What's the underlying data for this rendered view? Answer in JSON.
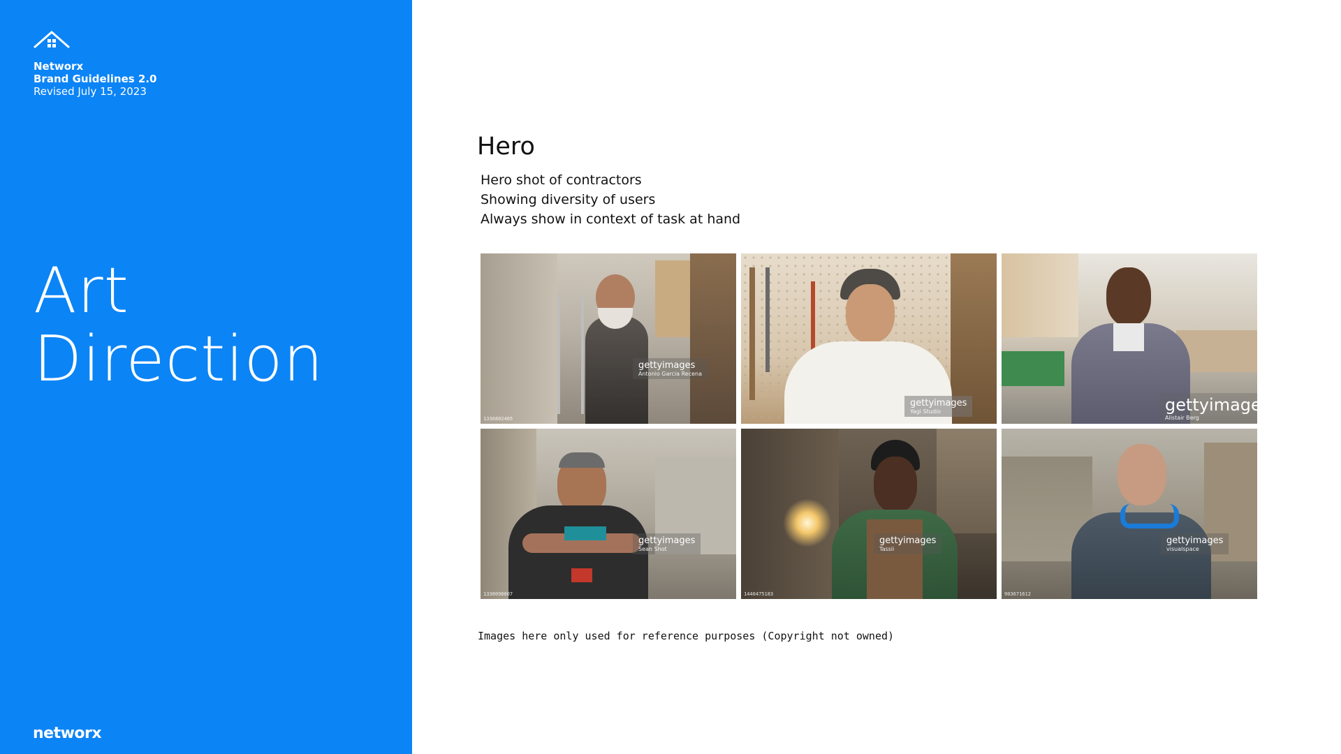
{
  "sidebar": {
    "brand_name": "Networx",
    "doc_title": "Brand Guidelines 2.0",
    "revision": "Revised July 15, 2023",
    "page_title_line1": "Art",
    "page_title_line2": "Direction",
    "wordmark": "networx",
    "background_color": "#0b84f6"
  },
  "main": {
    "section_title": "Hero",
    "bullets": [
      "Hero shot of contractors",
      "Showing diversity of users",
      "Always show in context of task at hand"
    ],
    "photos": [
      {
        "watermark": "gettyimages",
        "credit": "Antonio Garcia Recena",
        "id": "1336802405"
      },
      {
        "watermark": "gettyimages",
        "credit": "Yagi Studio",
        "id": ""
      },
      {
        "watermark": "gettyimages",
        "credit": "Alistair Berg",
        "id": ""
      },
      {
        "watermark": "gettyimages",
        "credit": "Sean Shot",
        "id": "1338098007"
      },
      {
        "watermark": "gettyimages",
        "credit": "Tassii",
        "id": "1440475183"
      },
      {
        "watermark": "gettyimages",
        "credit": "visualspace",
        "id": "903671612"
      }
    ],
    "footnote": "Images here only used for reference purposes (Copyright not owned)"
  }
}
